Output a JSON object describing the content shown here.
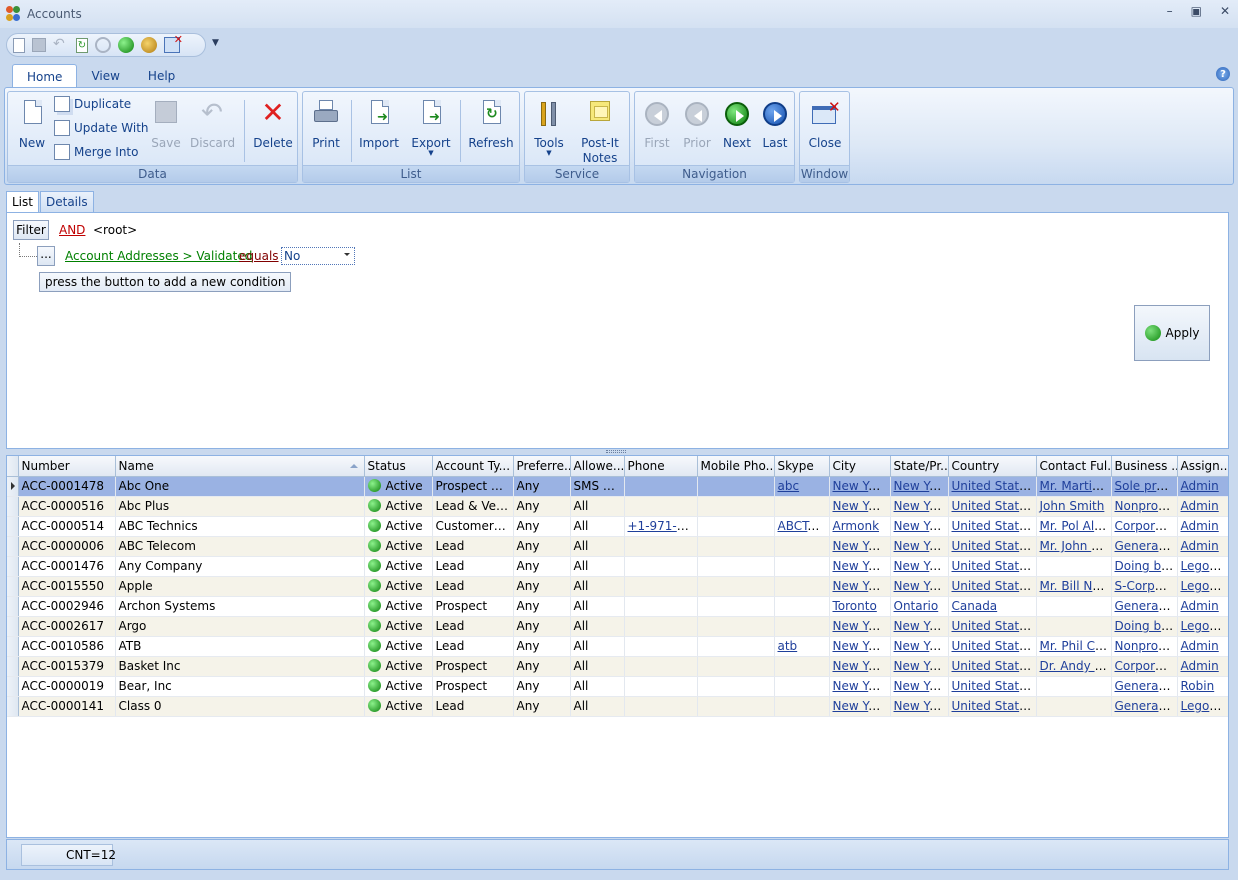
{
  "window": {
    "title": "Accounts"
  },
  "ribbon": {
    "tabs": [
      "Home",
      "View",
      "Help"
    ],
    "groups": {
      "data": {
        "caption": "Data",
        "new": "New",
        "duplicate": "Duplicate",
        "update_with": "Update With",
        "merge_into": "Merge Into",
        "save": "Save",
        "discard": "Discard",
        "delete": "Delete"
      },
      "list": {
        "caption": "List",
        "print": "Print",
        "import": "Import",
        "export": "Export",
        "refresh": "Refresh"
      },
      "service": {
        "caption": "Service",
        "tools": "Tools",
        "postit": "Post-It Notes"
      },
      "navigation": {
        "caption": "Navigation",
        "first": "First",
        "prior": "Prior",
        "next": "Next",
        "last": "Last"
      },
      "window": {
        "caption": "Window",
        "close": "Close"
      }
    }
  },
  "page_tabs": [
    "List",
    "Details"
  ],
  "filter": {
    "button": "Filter",
    "group_op": "AND",
    "root": "<root>",
    "ellipsis": "...",
    "field": "Account Addresses > Validated",
    "operator": "equals",
    "value": "No",
    "hint": "press the button to add a new condition",
    "apply": "Apply"
  },
  "grid": {
    "columns": [
      "Number",
      "Name",
      "Status",
      "Account Ty...",
      "Preferre...",
      "Allowe...",
      "Phone",
      "Mobile Pho...",
      "Skype",
      "City",
      "State/Pr...",
      "Country",
      "Contact Ful...",
      "Business ...",
      "Assign..."
    ],
    "rows": [
      [
        "ACC-0001478",
        "Abc One",
        "Active",
        "Prospect & ...",
        "Any",
        "SMS & ...",
        "",
        "",
        "abc",
        "New York",
        "New York",
        "United States",
        "Mr. Martin ...",
        "Sole prop...",
        "Admin"
      ],
      [
        "ACC-0000516",
        "Abc Plus",
        "Active",
        "Lead & Ven...",
        "Any",
        "All",
        "",
        "",
        "",
        "New York",
        "New York",
        "United States",
        "John Smith",
        "Nonprofit...",
        "Admin"
      ],
      [
        "ACC-0000514",
        "ABC Technics",
        "Active",
        "Customer &...",
        "Any",
        "All",
        "+1-971-53...",
        "",
        "ABCTe...",
        "Armonk",
        "New York",
        "United States",
        "Mr. Pol Allen",
        "Corporati...",
        "Admin"
      ],
      [
        "ACC-0000006",
        "ABC Telecom",
        "Active",
        "Lead",
        "Any",
        "All",
        "",
        "",
        "",
        "New York",
        "New York",
        "United States",
        "Mr. John A...",
        "General p...",
        "Admin"
      ],
      [
        "ACC-0001476",
        "Any Company",
        "Active",
        "Lead",
        "Any",
        "All",
        "",
        "",
        "",
        "New York",
        "New York",
        "United States",
        "",
        "Doing bu...",
        "Legolas"
      ],
      [
        "ACC-0015550",
        "Apple",
        "Active",
        "Lead",
        "Any",
        "All",
        "",
        "",
        "",
        "New York",
        "New York",
        "United States",
        "Mr. Bill Ne...",
        "S-Corpor...",
        "Legolas"
      ],
      [
        "ACC-0002946",
        "Archon Systems",
        "Active",
        "Prospect",
        "Any",
        "All",
        "",
        "",
        "",
        "Toronto",
        "Ontario",
        "Canada",
        "",
        "General p...",
        "Admin"
      ],
      [
        "ACC-0002617",
        "Argo",
        "Active",
        "Lead",
        "Any",
        "All",
        "",
        "",
        "",
        "New York",
        "New York",
        "United States",
        "",
        "Doing bu...",
        "Legolas"
      ],
      [
        "ACC-0010586",
        "ATB",
        "Active",
        "Lead",
        "Any",
        "All",
        "",
        "",
        "atb",
        "New York",
        "New York",
        "United States",
        "Mr. Phil Co...",
        "Nonprofit...",
        "Admin"
      ],
      [
        "ACC-0015379",
        "Basket Inc",
        "Active",
        "Prospect",
        "Any",
        "All",
        "",
        "",
        "",
        "New York",
        "New York",
        "United States",
        "Dr. Andy D...",
        "Corporati...",
        "Admin"
      ],
      [
        "ACC-0000019",
        "Bear, Inc",
        "Active",
        "Prospect",
        "Any",
        "All",
        "",
        "",
        "",
        "New York",
        "New York",
        "United States",
        "",
        "General p...",
        "Robin"
      ],
      [
        "ACC-0000141",
        "Class 0",
        "Active",
        "Lead",
        "Any",
        "All",
        "",
        "",
        "",
        "New York",
        "New York",
        "United States",
        "",
        "General p...",
        "Legolas"
      ]
    ]
  },
  "status": {
    "count": "CNT=12"
  },
  "colors": {
    "accent": "#15428b",
    "selection": "#9ab2e3",
    "alt_row": "#f5f3e9",
    "link": "#1f3f9b"
  }
}
